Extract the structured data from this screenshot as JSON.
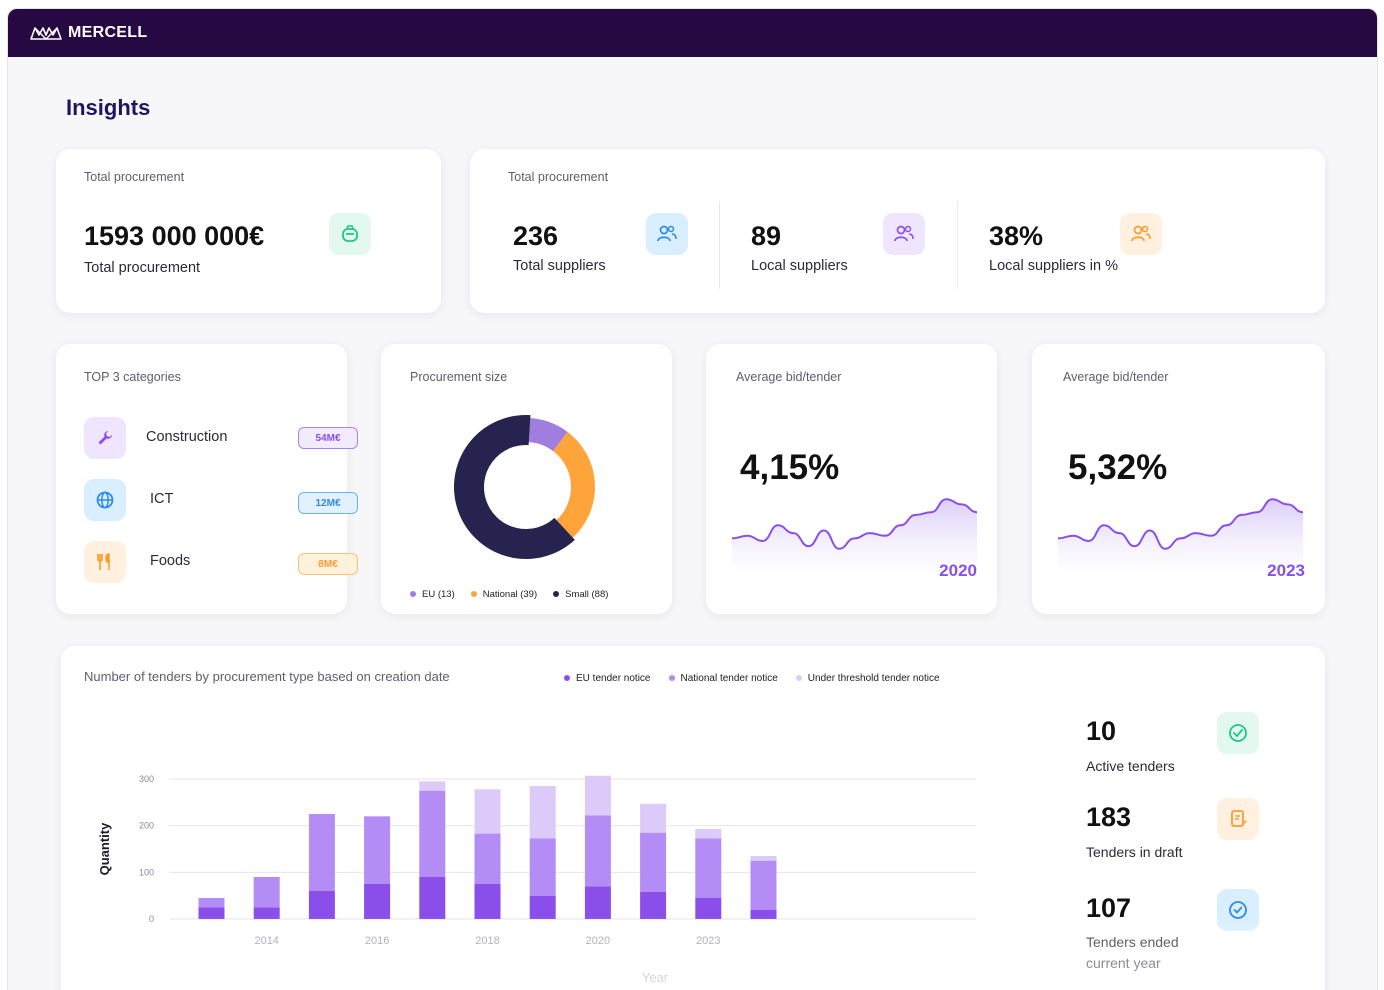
{
  "brand": {
    "name": "MERCELL"
  },
  "page": {
    "title": "Insights"
  },
  "total_card": {
    "label": "Total procurement",
    "value": "1593 000 000€",
    "caption": "Total procurement"
  },
  "suppliers_card": {
    "label": "Total procurement",
    "items": [
      {
        "value": "236",
        "caption": "Total suppliers"
      },
      {
        "value": "89",
        "caption": "Local suppliers"
      },
      {
        "value": "38%",
        "caption": "Local suppliers in %"
      }
    ]
  },
  "categories_card": {
    "label": "TOP 3 categories",
    "items": [
      {
        "name": "Construction",
        "amount": "54M€"
      },
      {
        "name": "ICT",
        "amount": "12M€"
      },
      {
        "name": "Foods",
        "amount": "8M€"
      }
    ]
  },
  "size_card": {
    "label": "Procurement size",
    "legend": [
      "EU (13)",
      "National (39)",
      "Small (88)"
    ]
  },
  "bid_card_1": {
    "label": "Average bid/tender",
    "value": "4,15%",
    "year": "2020"
  },
  "bid_card_2": {
    "label": "Average bid/tender",
    "value": "5,32%",
    "year": "2023"
  },
  "tenders_card": {
    "title": "Number of tenders by procurement type based on creation date",
    "legend": [
      "EU tender notice",
      "National tender notice",
      "Under threshold tender notice"
    ],
    "stats": [
      {
        "value": "10",
        "caption": "Active tenders"
      },
      {
        "value": "183",
        "caption": "Tenders in draft"
      },
      {
        "value": "107",
        "caption": "Tenders ended current year"
      }
    ]
  },
  "colors": {
    "eu": "#8a4fea",
    "national": "#b48cf5",
    "under": "#dccbf8",
    "orange": "#ffa43a",
    "navy": "#26234f"
  },
  "chart_data": [
    {
      "type": "pie",
      "title": "Procurement size",
      "labels": [
        "EU",
        "National",
        "Small"
      ],
      "values": [
        13,
        39,
        88
      ]
    },
    {
      "type": "area",
      "title": "Average bid/tender",
      "x_label_shown": "2020",
      "values": [
        3.1,
        3.2,
        3.0,
        3.6,
        3.3,
        2.8,
        3.4,
        2.7,
        3.1,
        3.3,
        3.2,
        3.6,
        4.0,
        4.1,
        4.6,
        4.4,
        4.1
      ]
    },
    {
      "type": "area",
      "title": "Average bid/tender",
      "x_label_shown": "2023",
      "values": [
        3.1,
        3.2,
        3.0,
        3.6,
        3.3,
        2.8,
        3.4,
        2.7,
        3.1,
        3.3,
        3.2,
        3.6,
        4.0,
        4.1,
        4.6,
        4.4,
        4.1
      ]
    },
    {
      "type": "bar",
      "stacked": true,
      "title": "Number of tenders by procurement type based on creation date",
      "xlabel": "Year",
      "ylabel": "Quantity",
      "ylim": [
        0,
        300
      ],
      "yticks": [
        0,
        100,
        200,
        300
      ],
      "x_tick_labels": [
        "2014",
        "2016",
        "2018",
        "2020",
        "2023"
      ],
      "categories": [
        "2013",
        "2014",
        "2015",
        "2016",
        "2017",
        "2018",
        "2019",
        "2020",
        "2021",
        "2022",
        "2023"
      ],
      "series": [
        {
          "name": "EU tender notice",
          "values": [
            25,
            25,
            60,
            75,
            90,
            75,
            50,
            70,
            58,
            45,
            20
          ]
        },
        {
          "name": "National tender notice",
          "values": [
            20,
            65,
            165,
            145,
            185,
            108,
            123,
            152,
            127,
            128,
            105
          ]
        },
        {
          "name": "Under threshold tender notice",
          "values": [
            0,
            0,
            0,
            0,
            20,
            95,
            112,
            85,
            62,
            20,
            10
          ]
        }
      ]
    }
  ]
}
